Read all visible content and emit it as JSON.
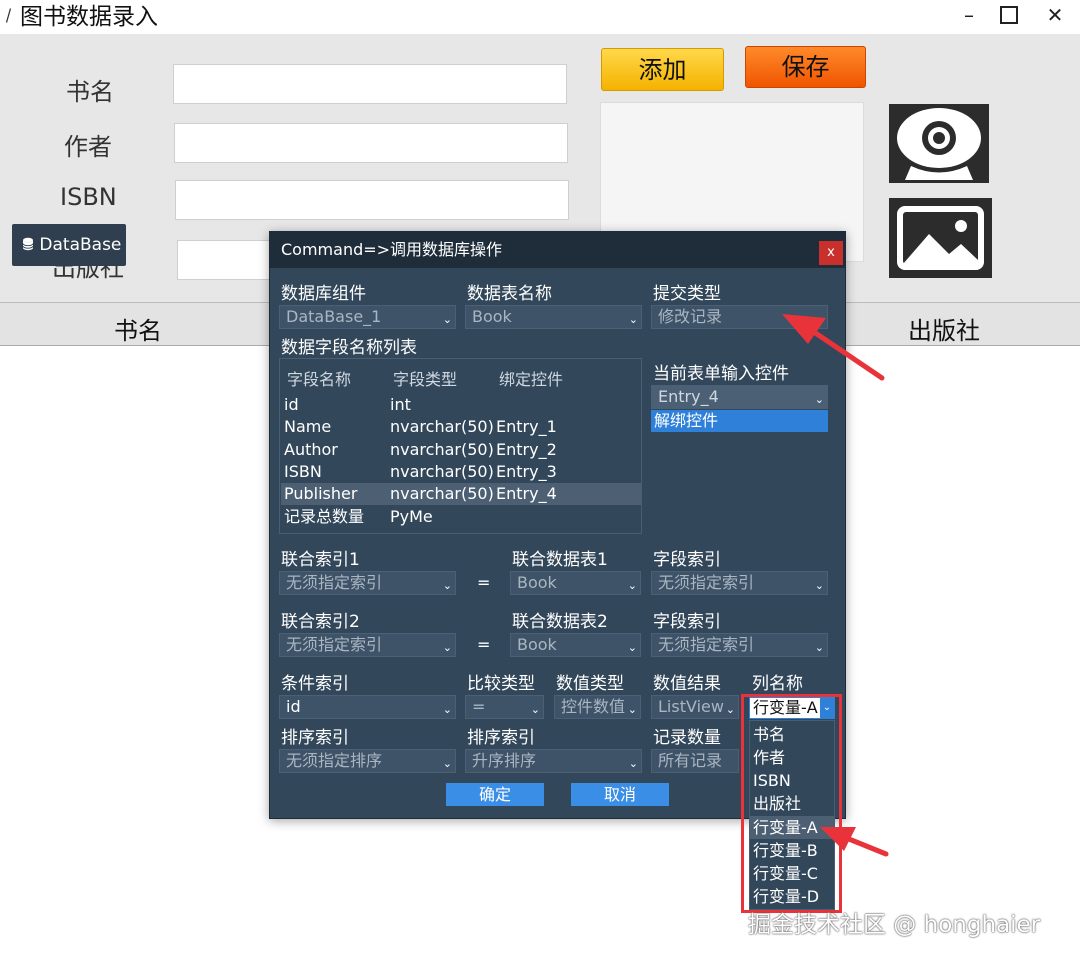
{
  "window": {
    "title": "图书数据录入",
    "min_glyph": "–",
    "close_glyph": "✕"
  },
  "form": {
    "label_name": "书名",
    "label_author": "作者",
    "label_isbn": "ISBN",
    "label_publisher": "出版社",
    "value_name": "",
    "value_author": "",
    "value_isbn": "",
    "value_publisher": ""
  },
  "toolbar": {
    "add_label": "添加",
    "save_label": "保存",
    "database_label": "DataBase"
  },
  "list": {
    "columns": [
      "书名",
      "出版社"
    ]
  },
  "dialog": {
    "title": "Command=>调用数据库操作",
    "close_glyph": "x",
    "db_component_label": "数据库组件",
    "db_component_value": "DataBase_1",
    "table_label": "数据表名称",
    "table_value": "Book",
    "submit_type_label": "提交类型",
    "submit_type_value": "修改记录",
    "fields_list_label": "数据字段名称列表",
    "fields_columns": [
      "字段名称",
      "字段类型",
      "绑定控件"
    ],
    "fields": [
      {
        "name": "id",
        "type": "int",
        "bind": ""
      },
      {
        "name": "Name",
        "type": "nvarchar(50)",
        "bind": "Entry_1"
      },
      {
        "name": "Author",
        "type": "nvarchar(50)",
        "bind": "Entry_2"
      },
      {
        "name": "ISBN",
        "type": "nvarchar(50)",
        "bind": "Entry_3"
      },
      {
        "name": "Publisher",
        "type": "nvarchar(50)",
        "bind": "Entry_4"
      },
      {
        "name": "记录总数量",
        "type": "PyMe",
        "bind": ""
      }
    ],
    "current_input_label": "当前表单输入控件",
    "current_input_value": "Entry_4",
    "unbind_label": "解绑控件",
    "join_index1_label": "联合索引1",
    "join_index1_value": "无须指定索引",
    "join_table1_label": "联合数据表1",
    "join_table1_value": "Book",
    "field_index1_label": "字段索引",
    "field_index1_value": "无须指定索引",
    "join_index2_label": "联合索引2",
    "join_index2_value": "无须指定索引",
    "join_table2_label": "联合数据表2",
    "join_table2_value": "Book",
    "field_index2_label": "字段索引",
    "field_index2_value": "无须指定索引",
    "equals": "=",
    "cond_index_label": "条件索引",
    "cond_index_value": "id",
    "compare_label": "比较类型",
    "compare_value": "=",
    "value_type_label": "数值类型",
    "value_type_value": "控件数值",
    "value_result_label": "数值结果",
    "value_result_value": "ListView",
    "col_name_label": "列名称",
    "col_name_value": "行变量-A",
    "sort_index1_label": "排序索引",
    "sort_index1_value": "无须指定排序",
    "sort_index2_label": "排序索引",
    "sort_index2_value": "升序排序",
    "record_count_label": "记录数量",
    "record_count_value": "所有记录",
    "ok_label": "确定",
    "cancel_label": "取消",
    "col_name_options": [
      "书名",
      "作者",
      "ISBN",
      "出版社",
      "行变量-A",
      "行变量-B",
      "行变量-C",
      "行变量-D"
    ]
  },
  "watermark": "掘金技术社区 @ honghaier",
  "colors": {
    "dialog_bg": "#33475b",
    "dialog_title_bg": "#1f2d3a",
    "accent_blue": "#2f80d8",
    "highlight_red": "#e8333b",
    "add_button": "#f5b200",
    "save_button": "#f05500"
  }
}
